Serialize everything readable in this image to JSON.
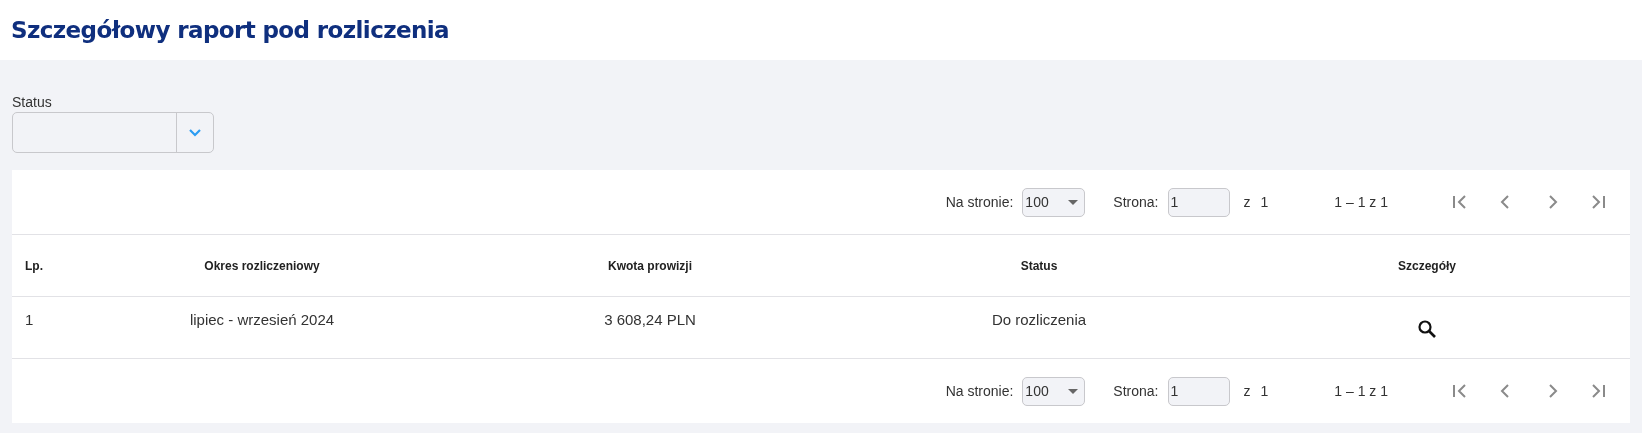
{
  "page_title": "Szczegółowy raport pod rozliczenia",
  "filter": {
    "label": "Status"
  },
  "paginators": [
    {
      "per_page_label": "Na stronie:",
      "per_page": "100",
      "page_label": "Strona:",
      "page": "1",
      "of_label": "z",
      "page_count": "1",
      "range": "1 – 1 z 1",
      "nav": [
        {
          "kind": "first",
          "disabled": true
        },
        {
          "kind": "prev",
          "disabled": true
        },
        {
          "kind": "next",
          "disabled": true
        },
        {
          "kind": "last",
          "disabled": true
        }
      ]
    },
    {
      "per_page_label": "Na stronie:",
      "per_page": "100",
      "page_label": "Strona:",
      "page": "1",
      "of_label": "z",
      "page_count": "1",
      "range": "1 – 1 z 1",
      "nav": [
        {
          "kind": "first",
          "disabled": true
        },
        {
          "kind": "prev",
          "disabled": true
        },
        {
          "kind": "next",
          "disabled": true
        },
        {
          "kind": "last",
          "disabled": true
        }
      ]
    }
  ],
  "table": {
    "columns": [
      "Lp.",
      "Okres rozliczeniowy",
      "Kwota prowizji",
      "Status",
      "Szczegóły"
    ],
    "rows": [
      {
        "cells": [
          "1",
          "lipiec - wrzesień 2024",
          "3 608,24 PLN",
          "Do rozliczenia"
        ],
        "details": true
      }
    ]
  }
}
